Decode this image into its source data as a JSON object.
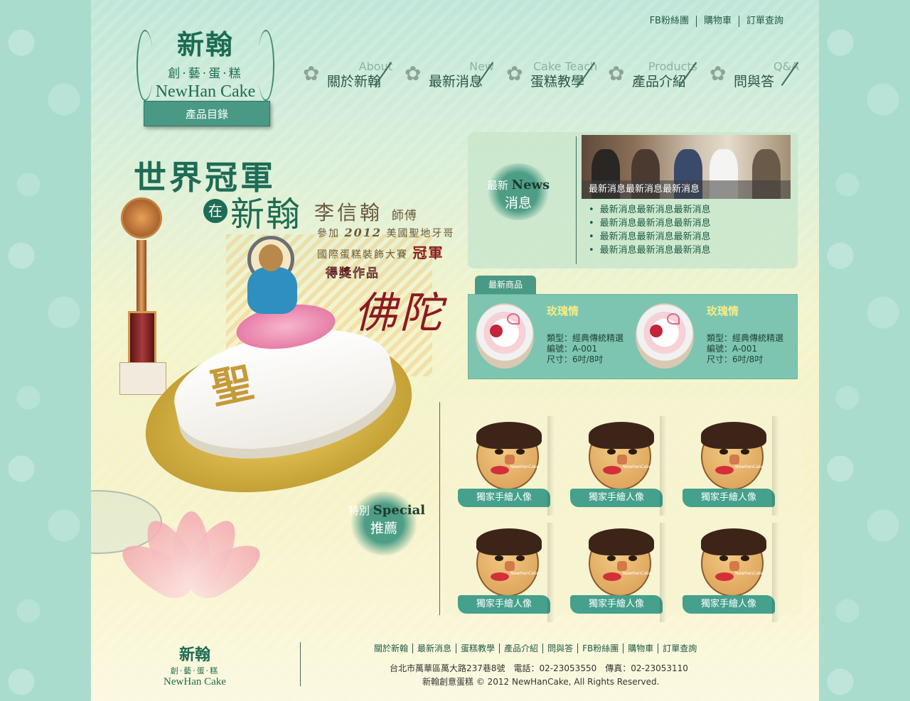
{
  "top_links": [
    "FB粉絲團",
    "購物車",
    "訂單查詢"
  ],
  "logo": {
    "zh": "新翰",
    "sub": "創·藝·蛋·糕",
    "en": "NewHan Cake"
  },
  "catalog_button": "產品目錄",
  "nav": [
    {
      "en": "About",
      "zh": "關於新翰"
    },
    {
      "en": "New",
      "zh": "最新消息"
    },
    {
      "en": "Cake Teach",
      "zh": "蛋糕教學"
    },
    {
      "en": "Products",
      "zh": "產品介紹"
    },
    {
      "en": "Q&A",
      "zh": "問與答"
    }
  ],
  "hero": {
    "title": "世界冠軍",
    "at": "在",
    "brand": "新翰",
    "name": "李信翰",
    "name_suffix": "師傅",
    "line1_prefix": "參加",
    "line1_year": "2012",
    "line1_suffix": "美國聖地牙哥",
    "line2_prefix": "國際蛋糕裝飾大賽",
    "line2_crown": "冠軍",
    "work": "得獎作品",
    "buddha": "佛陀"
  },
  "news": {
    "badge_zh_top": "最新",
    "badge_en": "News",
    "badge_zh_bottom": "消息",
    "photo_caption": "最新消息最新消息最新消息",
    "items": [
      "最新消息最新消息最新消息",
      "最新消息最新消息最新消息",
      "最新消息最新消息最新消息",
      "最新消息最新消息最新消息"
    ]
  },
  "latest_products": {
    "tab": "最新商品",
    "items": [
      {
        "name": "玫瑰情",
        "type": "類型：經典傳統精選",
        "code": "編號：A-001",
        "size": "尺寸：6吋/8吋"
      },
      {
        "name": "玫瑰情",
        "type": "類型：經典傳統精選",
        "code": "編號：A-001",
        "size": "尺寸：6吋/8吋"
      }
    ]
  },
  "special": {
    "badge_zh_top": "特別",
    "badge_en": "Special",
    "badge_zh_bottom": "推薦",
    "items": [
      {
        "label": "獨家手繪人像",
        "watermark": "NewHanCake"
      },
      {
        "label": "獨家手繪人像",
        "watermark": "NewHanCake"
      },
      {
        "label": "獨家手繪人像",
        "watermark": "NewHanCake"
      },
      {
        "label": "獨家手繪人像",
        "watermark": "NewHanCake"
      },
      {
        "label": "獨家手繪人像",
        "watermark": "NewHanCake"
      },
      {
        "label": "獨家手繪人像",
        "watermark": "NewHanCake"
      }
    ]
  },
  "footer": {
    "logo": {
      "zh": "新翰",
      "sub": "創·藝·蛋·糕",
      "en": "NewHan Cake"
    },
    "links": [
      "關於新翰",
      "最新消息",
      "蛋糕教學",
      "產品介紹",
      "問與答",
      "FB粉絲團",
      "購物車",
      "訂單查詢"
    ],
    "address": "台北市萬華區萬大路237巷8號　電話：02-23053550　傳真：02-23053110",
    "copyright": "新翰創意蛋糕 © 2012 NewHanCake, All Rights Reserved."
  },
  "colors": {
    "brand_green": "#1e6c55",
    "accent_teal": "#4a9985",
    "background": "#a9dccd",
    "product_name": "#f4ec8a"
  }
}
